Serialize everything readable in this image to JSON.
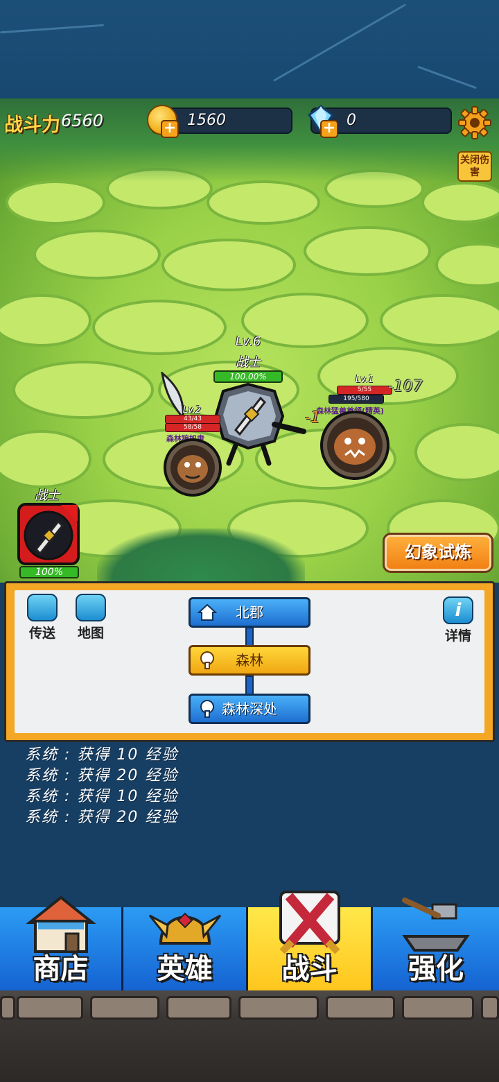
{
  "top_bar": {
    "power_label": "战斗力",
    "power_value": "6560",
    "gold": "1560",
    "gems": "0",
    "icons": [
      "coin-icon",
      "gem-icon",
      "gear-icon"
    ],
    "damage_button": "关闭伤害"
  },
  "units": {
    "hero": {
      "level": "Lv.6",
      "name": "战士",
      "hp_percent": "100.00%"
    },
    "enemy_left": {
      "level": "Lv.2",
      "hp_top": "43/43",
      "hp_bottom": "58/58",
      "name": "森林狼奴隶"
    },
    "enemy_right": {
      "level": "Lv.1",
      "hp_top": "5/55",
      "hp_bottom": "195/580",
      "name": "森林猛兽首领(精英)",
      "damage_text": "-107"
    },
    "damage_float": "-1",
    "portrait": {
      "name": "战士",
      "hp_percent": "100%"
    }
  },
  "trial_button": "幻象试炼",
  "map": {
    "teleport": "传送",
    "map": "地图",
    "details": "详情",
    "nodes": [
      "北郡",
      "森林",
      "森林深处"
    ],
    "active_index": 1
  },
  "log": [
    "系统 : 获得 10 经验",
    "系统 : 获得 20 经验",
    "系统 : 获得 10 经验",
    "系统 : 获得 20 经验"
  ],
  "nav": [
    {
      "label": "商店",
      "active": false
    },
    {
      "label": "英雄",
      "active": false
    },
    {
      "label": "战斗",
      "active": true
    },
    {
      "label": "强化",
      "active": false
    }
  ],
  "colors": {
    "accent_gold": "#ffd84a",
    "nav_blue": "#1563d2",
    "nav_active": "#ffc61e",
    "hp_green": "#36b926",
    "hp_red": "#d42626"
  }
}
